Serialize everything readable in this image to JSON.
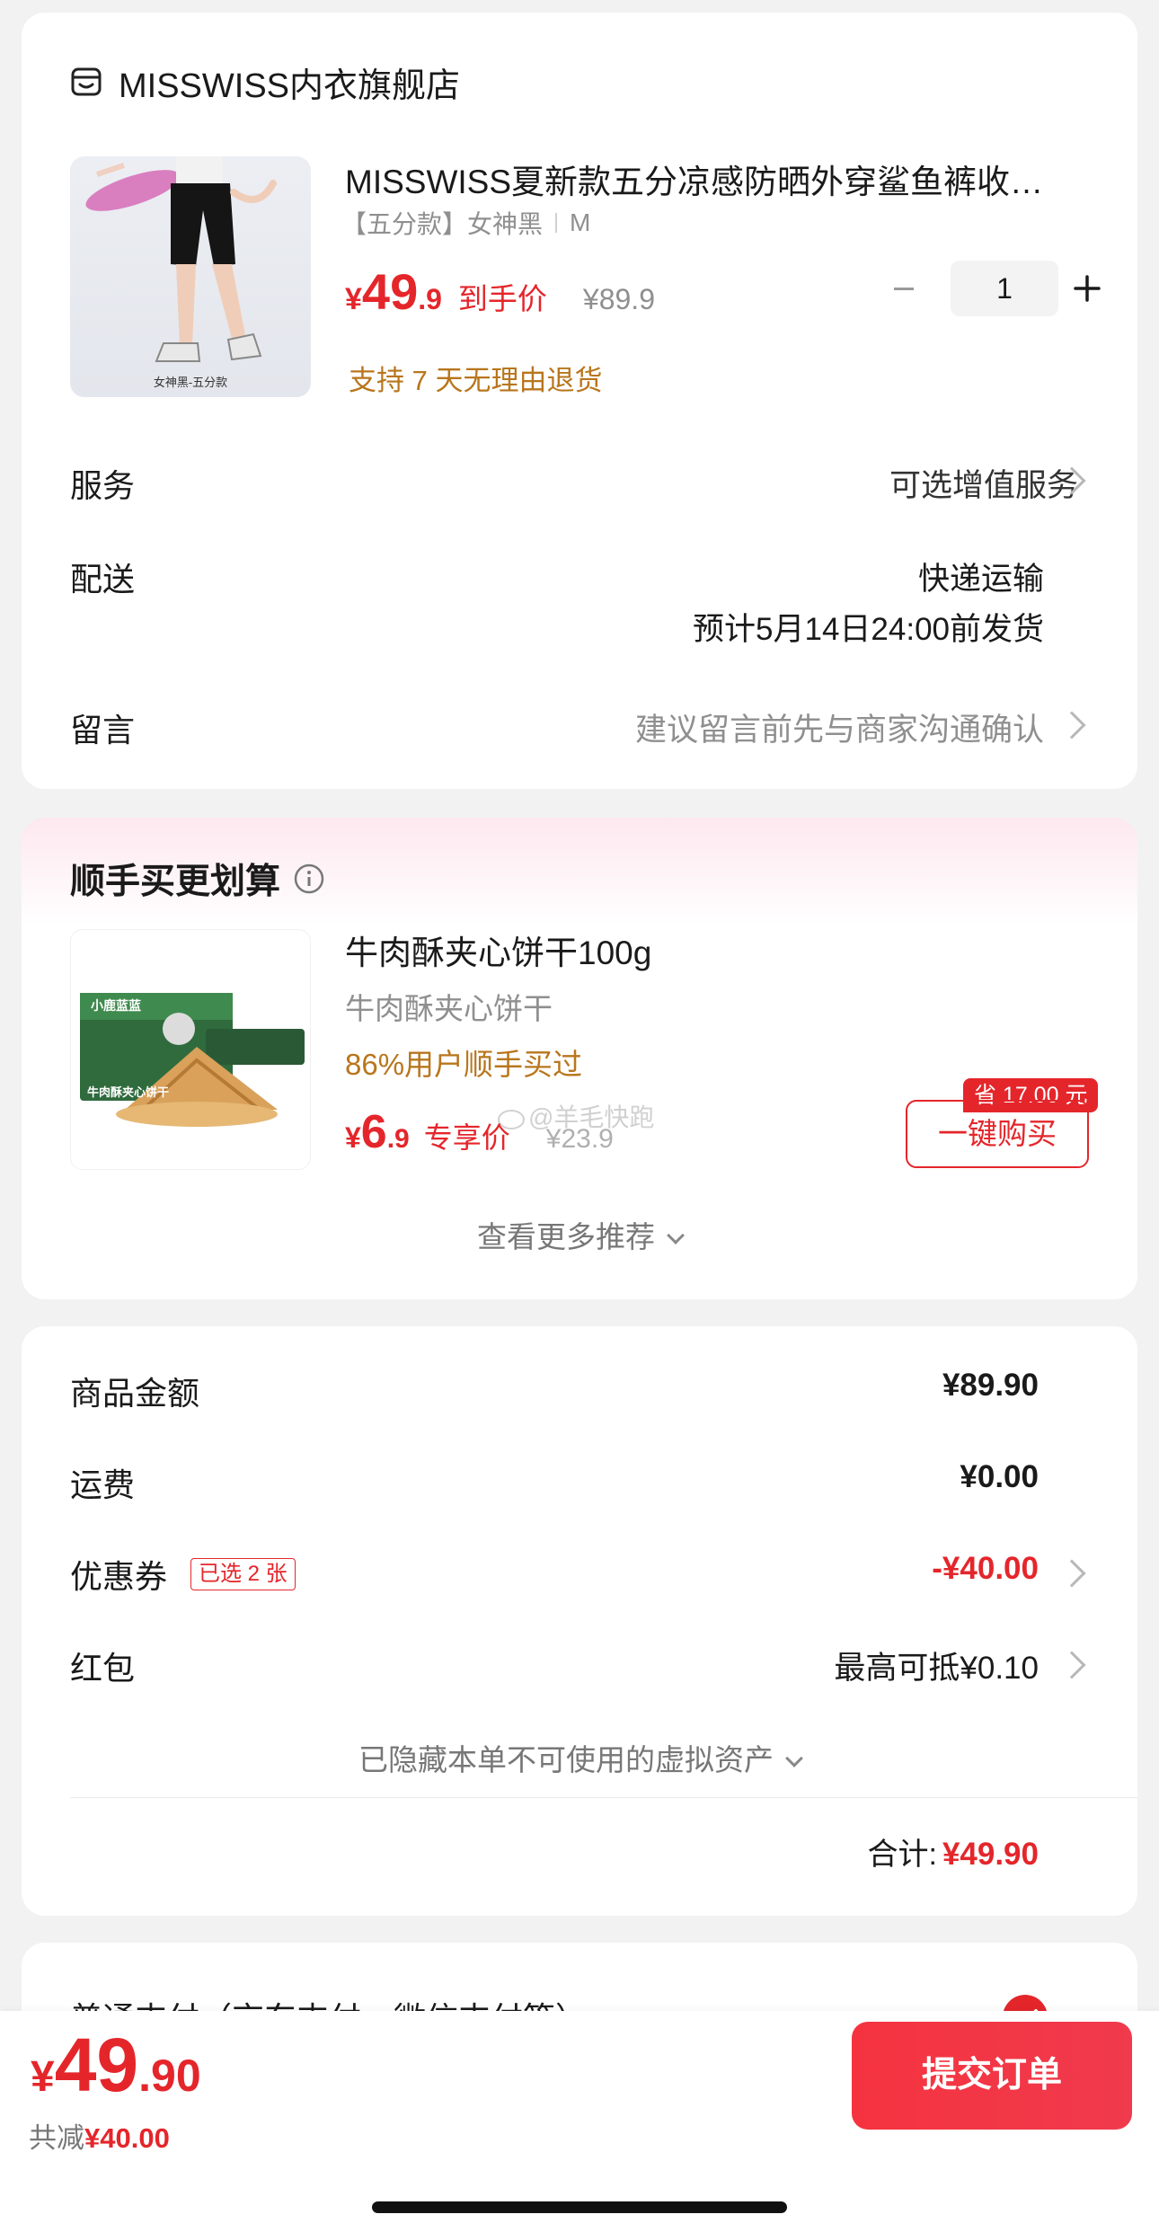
{
  "shop": {
    "name": "MISSWISS内衣旗舰店",
    "product": {
      "title": "MISSWISS夏新款五分凉感防晒外穿鲨鱼裤收…",
      "spec_tag": "【五分款】女神黑",
      "spec_size": "M",
      "image_caption": "女神黑-五分款",
      "price_symbol": "¥",
      "price_int": "49",
      "price_dec": ".9",
      "price_label": "到手价",
      "original_price": "¥89.9",
      "quantity": "1",
      "return_policy": "支持 7 天无理由退货"
    },
    "service": {
      "label": "服务",
      "value": "可选增值服务"
    },
    "delivery": {
      "label": "配送",
      "method": "快递运输",
      "eta": "预计5月14日24:00前发货"
    },
    "message": {
      "label": "留言",
      "placeholder": "建议留言前先与商家沟通确认"
    }
  },
  "addon": {
    "title": "顺手买更划算",
    "item": {
      "name": "牛肉酥夹心饼干100g",
      "subtitle": "牛肉酥夹心饼干",
      "popularity": "86%用户顺手买过",
      "price_symbol": "¥",
      "price_int": "6",
      "price_dec": ".9",
      "price_label": "专享价",
      "original_price": "¥23.9",
      "save_badge": "省 17.00 元",
      "buy_button": "一键购买",
      "box_text_1": "小鹿蓝蓝",
      "box_text_2": "牛肉酥夹心饼干"
    },
    "watermark": "@羊毛快跑",
    "more": "查看更多推荐"
  },
  "summary": {
    "goods_label": "商品金额",
    "goods_value": "¥89.90",
    "shipping_label": "运费",
    "shipping_value": "¥0.00",
    "coupon_label": "优惠券",
    "coupon_tag": "已选 2 张",
    "coupon_value": "-¥40.00",
    "redpacket_label": "红包",
    "redpacket_value": "最高可抵¥0.10",
    "hidden_assets": "已隐藏本单不可使用的虚拟资产",
    "total_label": "合计:",
    "total_value": "¥49.90"
  },
  "payment": {
    "label": "普通支付（京东支付、微信支付等）"
  },
  "bottom_bar": {
    "price_symbol": "¥",
    "price_int": "49",
    "price_dec": ".90",
    "discount_label": "共减",
    "discount_value": "¥40.00",
    "submit_label": "提交订单"
  },
  "colors": {
    "accent_red": "#e4262b",
    "gold": "#b8761c",
    "submit_gradient_start": "#f5333f",
    "submit_gradient_end": "#f03a4d"
  }
}
